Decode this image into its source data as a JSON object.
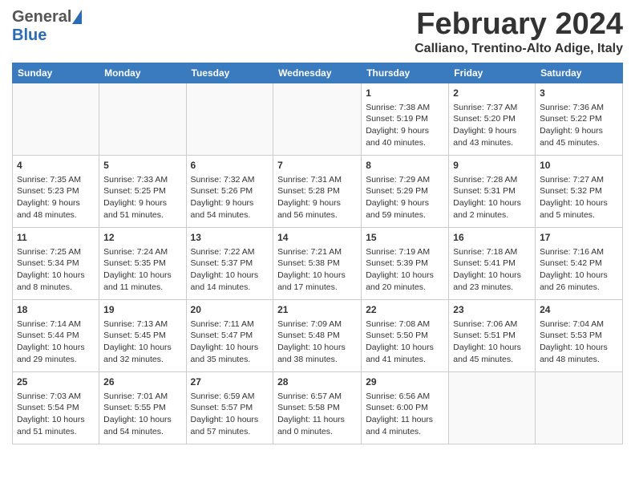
{
  "header": {
    "logo_general": "General",
    "logo_blue": "Blue",
    "month_title": "February 2024",
    "location": "Calliano, Trentino-Alto Adige, Italy"
  },
  "weekdays": [
    "Sunday",
    "Monday",
    "Tuesday",
    "Wednesday",
    "Thursday",
    "Friday",
    "Saturday"
  ],
  "weeks": [
    [
      {
        "day": "",
        "content": ""
      },
      {
        "day": "",
        "content": ""
      },
      {
        "day": "",
        "content": ""
      },
      {
        "day": "",
        "content": ""
      },
      {
        "day": "1",
        "content": "Sunrise: 7:38 AM\nSunset: 5:19 PM\nDaylight: 9 hours\nand 40 minutes."
      },
      {
        "day": "2",
        "content": "Sunrise: 7:37 AM\nSunset: 5:20 PM\nDaylight: 9 hours\nand 43 minutes."
      },
      {
        "day": "3",
        "content": "Sunrise: 7:36 AM\nSunset: 5:22 PM\nDaylight: 9 hours\nand 45 minutes."
      }
    ],
    [
      {
        "day": "4",
        "content": "Sunrise: 7:35 AM\nSunset: 5:23 PM\nDaylight: 9 hours\nand 48 minutes."
      },
      {
        "day": "5",
        "content": "Sunrise: 7:33 AM\nSunset: 5:25 PM\nDaylight: 9 hours\nand 51 minutes."
      },
      {
        "day": "6",
        "content": "Sunrise: 7:32 AM\nSunset: 5:26 PM\nDaylight: 9 hours\nand 54 minutes."
      },
      {
        "day": "7",
        "content": "Sunrise: 7:31 AM\nSunset: 5:28 PM\nDaylight: 9 hours\nand 56 minutes."
      },
      {
        "day": "8",
        "content": "Sunrise: 7:29 AM\nSunset: 5:29 PM\nDaylight: 9 hours\nand 59 minutes."
      },
      {
        "day": "9",
        "content": "Sunrise: 7:28 AM\nSunset: 5:31 PM\nDaylight: 10 hours\nand 2 minutes."
      },
      {
        "day": "10",
        "content": "Sunrise: 7:27 AM\nSunset: 5:32 PM\nDaylight: 10 hours\nand 5 minutes."
      }
    ],
    [
      {
        "day": "11",
        "content": "Sunrise: 7:25 AM\nSunset: 5:34 PM\nDaylight: 10 hours\nand 8 minutes."
      },
      {
        "day": "12",
        "content": "Sunrise: 7:24 AM\nSunset: 5:35 PM\nDaylight: 10 hours\nand 11 minutes."
      },
      {
        "day": "13",
        "content": "Sunrise: 7:22 AM\nSunset: 5:37 PM\nDaylight: 10 hours\nand 14 minutes."
      },
      {
        "day": "14",
        "content": "Sunrise: 7:21 AM\nSunset: 5:38 PM\nDaylight: 10 hours\nand 17 minutes."
      },
      {
        "day": "15",
        "content": "Sunrise: 7:19 AM\nSunset: 5:39 PM\nDaylight: 10 hours\nand 20 minutes."
      },
      {
        "day": "16",
        "content": "Sunrise: 7:18 AM\nSunset: 5:41 PM\nDaylight: 10 hours\nand 23 minutes."
      },
      {
        "day": "17",
        "content": "Sunrise: 7:16 AM\nSunset: 5:42 PM\nDaylight: 10 hours\nand 26 minutes."
      }
    ],
    [
      {
        "day": "18",
        "content": "Sunrise: 7:14 AM\nSunset: 5:44 PM\nDaylight: 10 hours\nand 29 minutes."
      },
      {
        "day": "19",
        "content": "Sunrise: 7:13 AM\nSunset: 5:45 PM\nDaylight: 10 hours\nand 32 minutes."
      },
      {
        "day": "20",
        "content": "Sunrise: 7:11 AM\nSunset: 5:47 PM\nDaylight: 10 hours\nand 35 minutes."
      },
      {
        "day": "21",
        "content": "Sunrise: 7:09 AM\nSunset: 5:48 PM\nDaylight: 10 hours\nand 38 minutes."
      },
      {
        "day": "22",
        "content": "Sunrise: 7:08 AM\nSunset: 5:50 PM\nDaylight: 10 hours\nand 41 minutes."
      },
      {
        "day": "23",
        "content": "Sunrise: 7:06 AM\nSunset: 5:51 PM\nDaylight: 10 hours\nand 45 minutes."
      },
      {
        "day": "24",
        "content": "Sunrise: 7:04 AM\nSunset: 5:53 PM\nDaylight: 10 hours\nand 48 minutes."
      }
    ],
    [
      {
        "day": "25",
        "content": "Sunrise: 7:03 AM\nSunset: 5:54 PM\nDaylight: 10 hours\nand 51 minutes."
      },
      {
        "day": "26",
        "content": "Sunrise: 7:01 AM\nSunset: 5:55 PM\nDaylight: 10 hours\nand 54 minutes."
      },
      {
        "day": "27",
        "content": "Sunrise: 6:59 AM\nSunset: 5:57 PM\nDaylight: 10 hours\nand 57 minutes."
      },
      {
        "day": "28",
        "content": "Sunrise: 6:57 AM\nSunset: 5:58 PM\nDaylight: 11 hours\nand 0 minutes."
      },
      {
        "day": "29",
        "content": "Sunrise: 6:56 AM\nSunset: 6:00 PM\nDaylight: 11 hours\nand 4 minutes."
      },
      {
        "day": "",
        "content": ""
      },
      {
        "day": "",
        "content": ""
      }
    ]
  ]
}
